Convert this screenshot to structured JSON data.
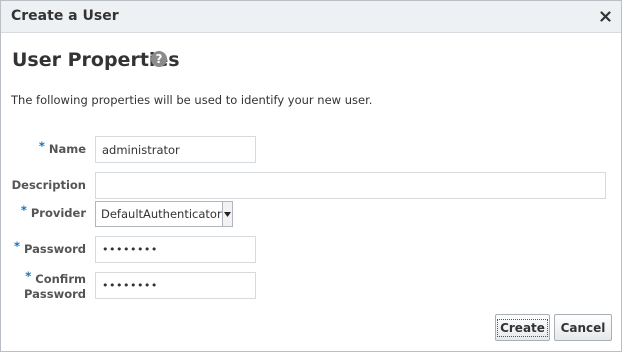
{
  "dialog": {
    "title": "Create a User",
    "close_icon": "close-icon"
  },
  "section": {
    "heading": "User Properties",
    "help_icon": "help-icon",
    "help_glyph": "?",
    "intro": "The following properties will be used to identify your new user."
  },
  "form": {
    "required_marker": "*",
    "name": {
      "label": "Name",
      "required": true,
      "value": "administrator"
    },
    "description": {
      "label": "Description",
      "required": false,
      "value": ""
    },
    "provider": {
      "label": "Provider",
      "required": true,
      "value": "DefaultAuthenticator"
    },
    "password": {
      "label": "Password",
      "required": true,
      "value": "••••••••"
    },
    "confirm_password": {
      "label_line1": "Confirm",
      "label_line2": "Password",
      "required": true,
      "value": "••••••••"
    }
  },
  "buttons": {
    "create_label": "Create",
    "cancel_label": "Cancel"
  },
  "colors": {
    "required_marker": "#1f6fb5",
    "titlebar_bg": "#eef1f4"
  }
}
